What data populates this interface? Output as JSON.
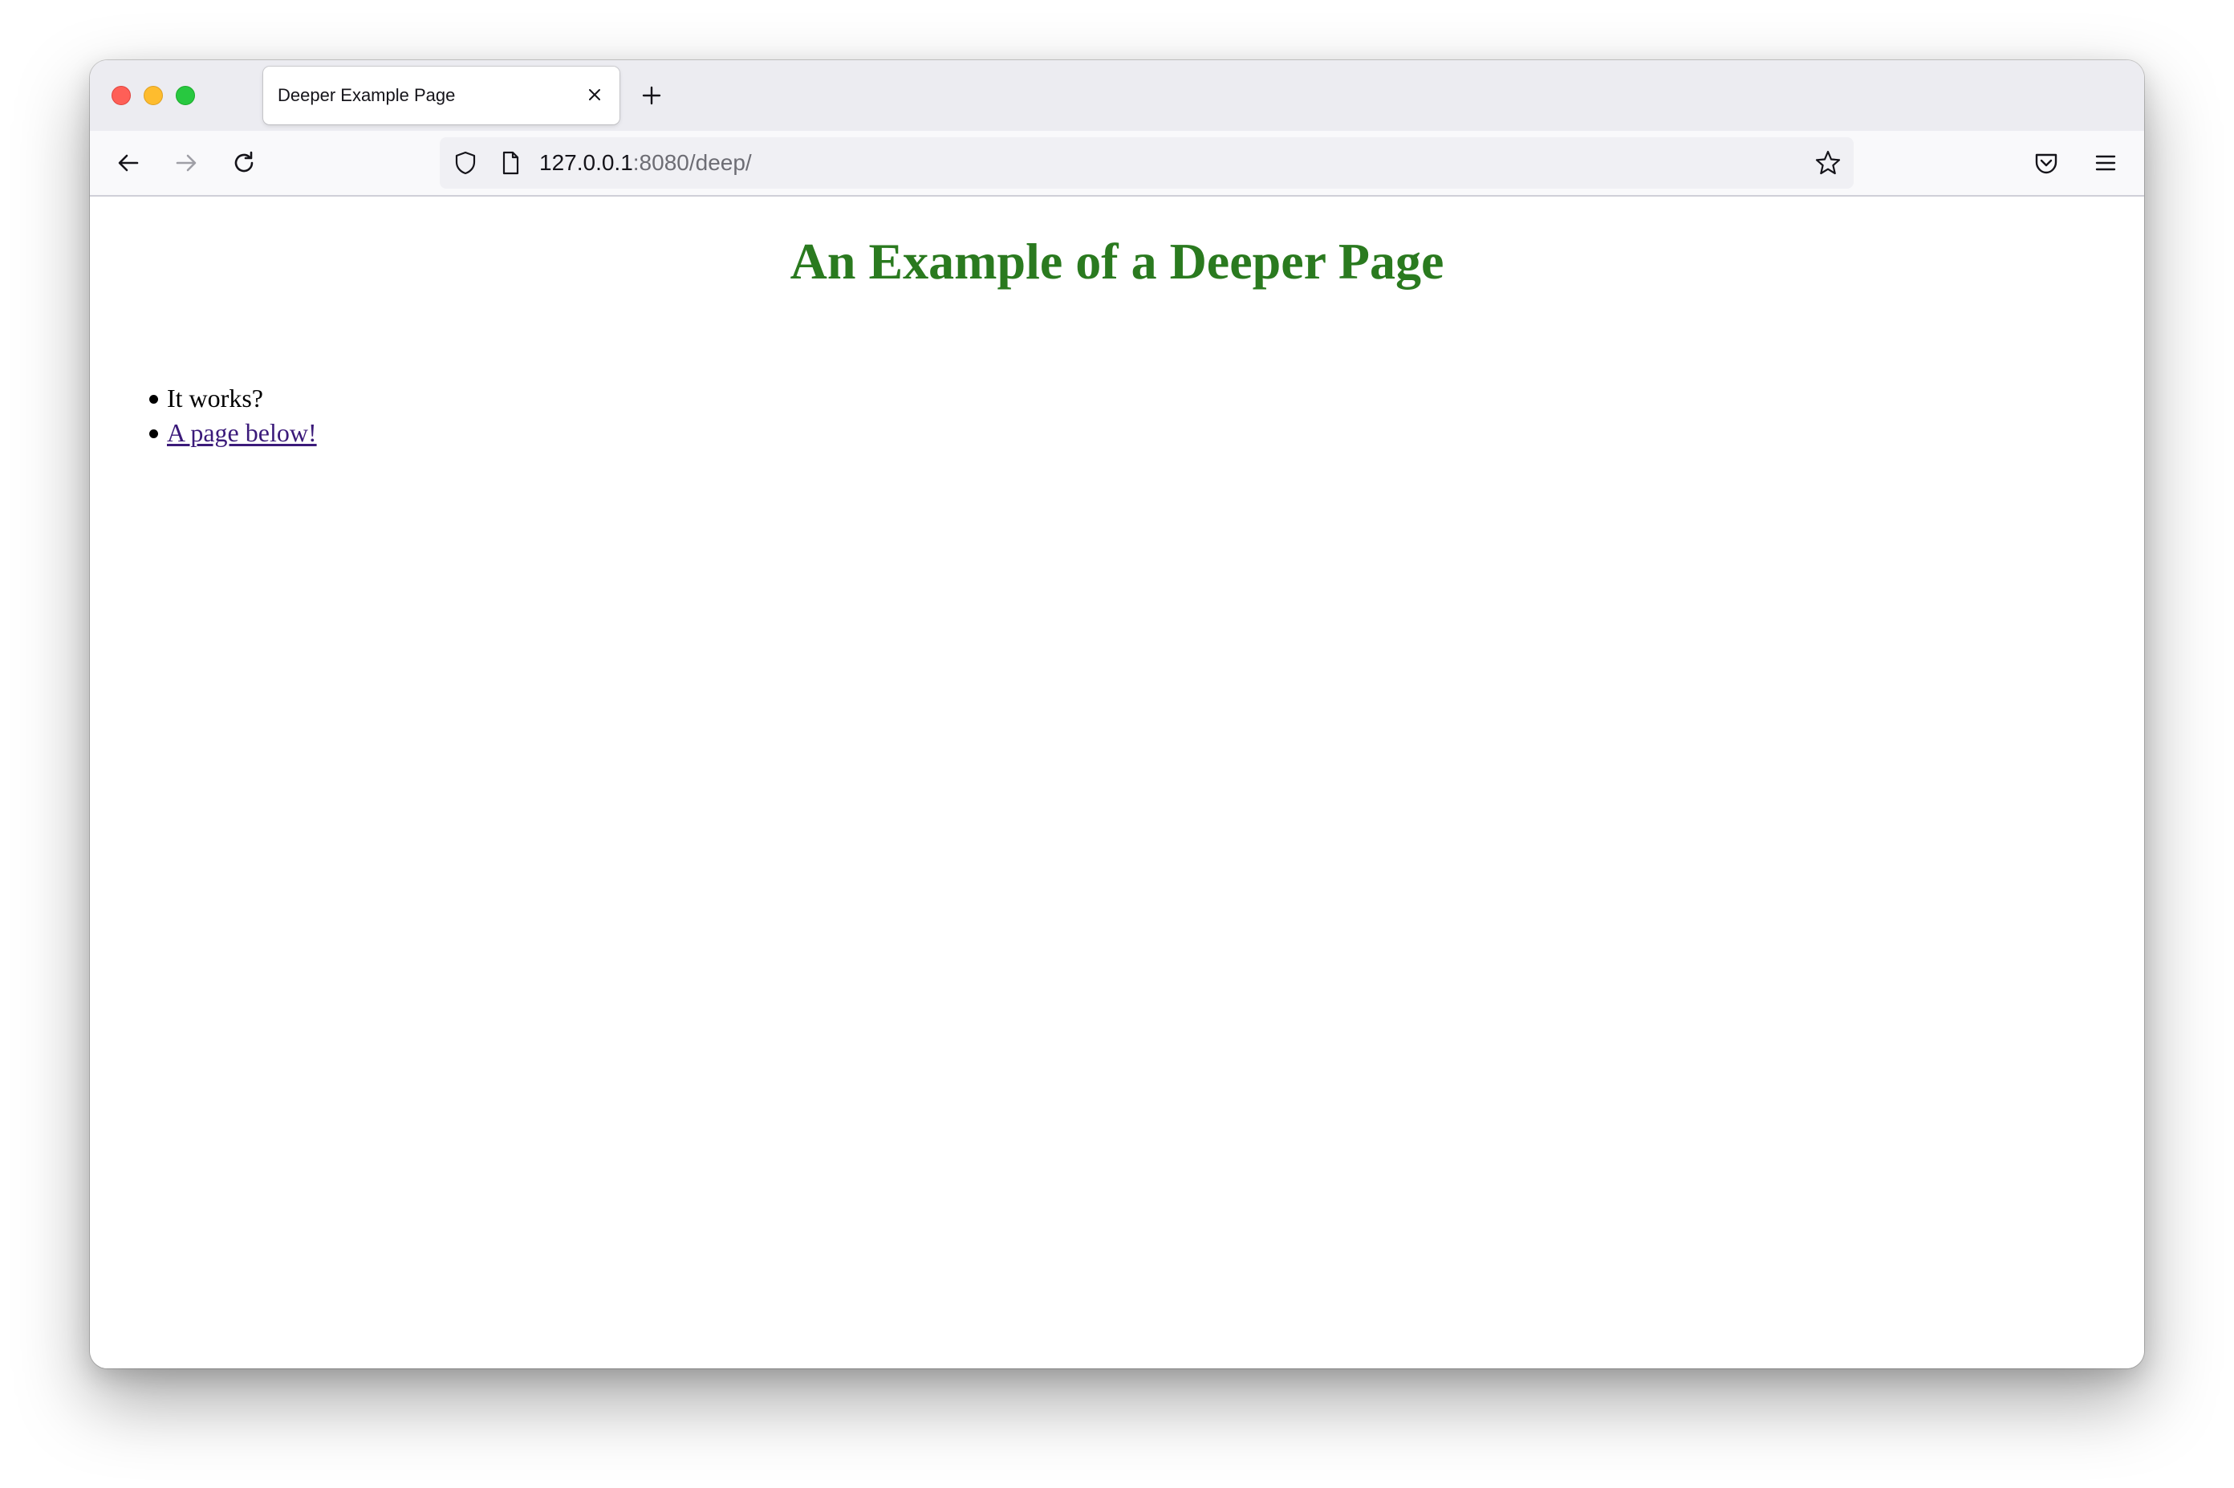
{
  "browser": {
    "tab": {
      "title": "Deeper Example Page"
    },
    "address_bar": {
      "host": "127.0.0.1",
      "path": ":8080/deep/"
    }
  },
  "page": {
    "heading": "An Example of a Deeper Page",
    "list_items": [
      {
        "text": "It works?"
      },
      {
        "text": "A page below!",
        "is_link": true
      }
    ],
    "colors": {
      "heading": "#2a7a1f",
      "visited_link": "#3b1a7a"
    }
  },
  "icons": {
    "window_controls": [
      "close-dot",
      "minimize-dot",
      "maximize-dot"
    ],
    "toolbar": [
      "back-arrow-icon",
      "forward-arrow-icon",
      "reload-icon",
      "shield-icon",
      "page-icon",
      "star-icon",
      "pocket-icon",
      "menu-icon"
    ]
  }
}
